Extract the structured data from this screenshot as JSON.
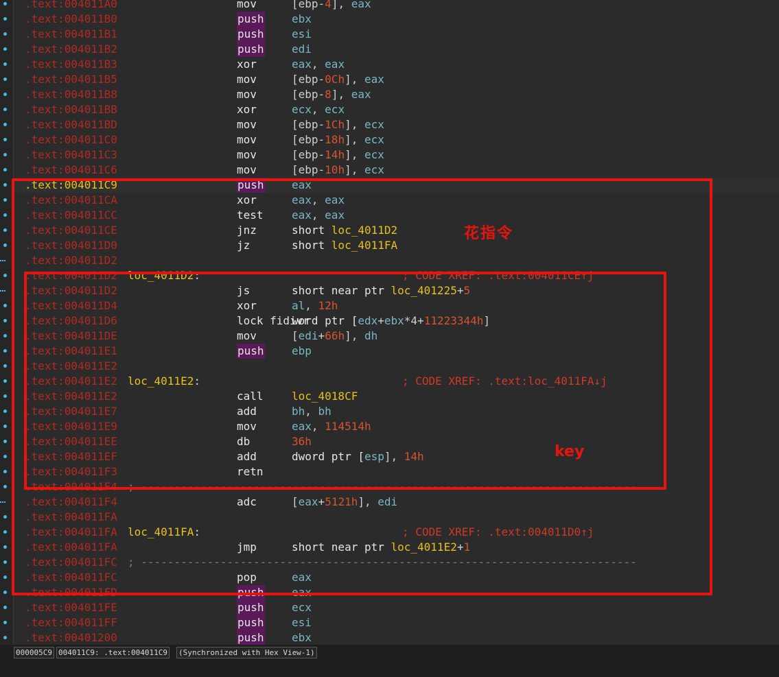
{
  "colors": {
    "background": "#2b2b2b",
    "address": "#b22a20",
    "current_address": "#e8c11a",
    "label": "#e8c11a",
    "register": "#7ab8c8",
    "number": "#d9532f",
    "annotation": "#e8140f"
  },
  "rows": [
    {
      "addr": ".text:004011A0",
      "mnem": "mov",
      "ops": [
        [
          "[ebp-",
          "sym"
        ],
        [
          "4",
          "n"
        ],
        [
          "], ",
          "sym"
        ],
        [
          "eax",
          "r"
        ]
      ]
    },
    {
      "addr": ".text:004011B0",
      "mnem": "push",
      "ops": [
        [
          "ebx",
          "r"
        ]
      ]
    },
    {
      "addr": ".text:004011B1",
      "mnem": "push",
      "ops": [
        [
          "esi",
          "r"
        ]
      ]
    },
    {
      "addr": ".text:004011B2",
      "mnem": "push",
      "ops": [
        [
          "edi",
          "r"
        ]
      ]
    },
    {
      "addr": ".text:004011B3",
      "mnem": "xor",
      "ops": [
        [
          "eax",
          "r"
        ],
        [
          ", ",
          "sym"
        ],
        [
          "eax",
          "r"
        ]
      ]
    },
    {
      "addr": ".text:004011B5",
      "mnem": "mov",
      "ops": [
        [
          "[ebp-",
          "sym"
        ],
        [
          "0Ch",
          "n"
        ],
        [
          "], ",
          "sym"
        ],
        [
          "eax",
          "r"
        ]
      ]
    },
    {
      "addr": ".text:004011B8",
      "mnem": "mov",
      "ops": [
        [
          "[ebp-",
          "sym"
        ],
        [
          "8",
          "n"
        ],
        [
          "], ",
          "sym"
        ],
        [
          "eax",
          "r"
        ]
      ]
    },
    {
      "addr": ".text:004011BB",
      "mnem": "xor",
      "ops": [
        [
          "ecx",
          "r"
        ],
        [
          ", ",
          "sym"
        ],
        [
          "ecx",
          "r"
        ]
      ]
    },
    {
      "addr": ".text:004011BD",
      "mnem": "mov",
      "ops": [
        [
          "[ebp-",
          "sym"
        ],
        [
          "1Ch",
          "n"
        ],
        [
          "], ",
          "sym"
        ],
        [
          "ecx",
          "r"
        ]
      ]
    },
    {
      "addr": ".text:004011C0",
      "mnem": "mov",
      "ops": [
        [
          "[ebp-",
          "sym"
        ],
        [
          "18h",
          "n"
        ],
        [
          "], ",
          "sym"
        ],
        [
          "ecx",
          "r"
        ]
      ]
    },
    {
      "addr": ".text:004011C3",
      "mnem": "mov",
      "ops": [
        [
          "[ebp-",
          "sym"
        ],
        [
          "14h",
          "n"
        ],
        [
          "], ",
          "sym"
        ],
        [
          "ecx",
          "r"
        ]
      ]
    },
    {
      "addr": ".text:004011C6",
      "mnem": "mov",
      "ops": [
        [
          "[ebp-",
          "sym"
        ],
        [
          "10h",
          "n"
        ],
        [
          "], ",
          "sym"
        ],
        [
          "ecx",
          "r"
        ]
      ]
    },
    {
      "addr": ".text:004011C9",
      "current": true,
      "mnem": "push",
      "ops": [
        [
          "eax",
          "r"
        ]
      ]
    },
    {
      "addr": ".text:004011CA",
      "mnem": "xor",
      "ops": [
        [
          "eax",
          "r"
        ],
        [
          ", ",
          "sym"
        ],
        [
          "eax",
          "r"
        ]
      ]
    },
    {
      "addr": ".text:004011CC",
      "mnem": "test",
      "ops": [
        [
          "eax",
          "r"
        ],
        [
          ", ",
          "sym"
        ],
        [
          "eax",
          "r"
        ]
      ]
    },
    {
      "addr": ".text:004011CE",
      "mnem": "jnz",
      "ops": [
        [
          "short ",
          "w"
        ],
        [
          "loc_4011D2",
          "y"
        ]
      ]
    },
    {
      "addr": ".text:004011D0",
      "mnem": "jz",
      "ops": [
        [
          "short ",
          "w"
        ],
        [
          "loc_4011FA",
          "y"
        ]
      ]
    },
    {
      "addr": ".text:004011D2"
    },
    {
      "addr": ".text:004011D2",
      "label": "loc_4011D2",
      "comment": "; CODE XREF: .text:004011CE↑j"
    },
    {
      "addr": ".text:004011D2",
      "mnem": "js",
      "ops": [
        [
          "short near ptr ",
          "w"
        ],
        [
          "loc_401225",
          "y"
        ],
        [
          "+",
          "sym"
        ],
        [
          "5",
          "n"
        ]
      ]
    },
    {
      "addr": ".text:004011D4",
      "mnem": "xor",
      "ops": [
        [
          "al",
          "r"
        ],
        [
          ", ",
          "sym"
        ],
        [
          "12h",
          "n"
        ]
      ]
    },
    {
      "addr": ".text:004011D6",
      "mnem": "lock fidivr",
      "ops": [
        [
          "word ptr [",
          "w"
        ],
        [
          "edx",
          "r"
        ],
        [
          "+",
          "sym"
        ],
        [
          "ebx",
          "r"
        ],
        [
          "*4+",
          "sym"
        ],
        [
          "11223344h",
          "n"
        ],
        [
          "]",
          "sym"
        ]
      ]
    },
    {
      "addr": ".text:004011DE",
      "mnem": "mov",
      "ops": [
        [
          "[",
          "sym"
        ],
        [
          "edi",
          "r"
        ],
        [
          "+",
          "sym"
        ],
        [
          "66h",
          "n"
        ],
        [
          "], ",
          "sym"
        ],
        [
          "dh",
          "r"
        ]
      ]
    },
    {
      "addr": ".text:004011E1",
      "mnem": "push",
      "ops": [
        [
          "ebp",
          "r"
        ]
      ]
    },
    {
      "addr": ".text:004011E2"
    },
    {
      "addr": ".text:004011E2",
      "label": "loc_4011E2",
      "comment": "; CODE XREF: .text:loc_4011FA↓j"
    },
    {
      "addr": ".text:004011E2",
      "mnem": "call",
      "ops": [
        [
          "loc_4018CF",
          "y"
        ]
      ]
    },
    {
      "addr": ".text:004011E7",
      "mnem": "add",
      "ops": [
        [
          "bh",
          "r"
        ],
        [
          ", ",
          "sym"
        ],
        [
          "bh",
          "r"
        ]
      ]
    },
    {
      "addr": ".text:004011E9",
      "mnem": "mov",
      "ops": [
        [
          "eax",
          "r"
        ],
        [
          ", ",
          "sym"
        ],
        [
          "114514h",
          "n"
        ]
      ]
    },
    {
      "addr": ".text:004011EE",
      "mnem": "db",
      "ops": [
        [
          "36h",
          "n"
        ]
      ]
    },
    {
      "addr": ".text:004011EF",
      "mnem": "add",
      "ops": [
        [
          "dword ptr [",
          "w"
        ],
        [
          "esp",
          "r"
        ],
        [
          "], ",
          "sym"
        ],
        [
          "14h",
          "n"
        ]
      ]
    },
    {
      "addr": ".text:004011F3",
      "mnem": "retn"
    },
    {
      "addr": ".text:004011F4",
      "sep": "; ---------------------------------------------------------------------------"
    },
    {
      "addr": ".text:004011F4",
      "mnem": "adc",
      "ops": [
        [
          "[",
          "sym"
        ],
        [
          "eax",
          "r"
        ],
        [
          "+",
          "sym"
        ],
        [
          "5121h",
          "n"
        ],
        [
          "], ",
          "sym"
        ],
        [
          "edi",
          "r"
        ]
      ]
    },
    {
      "addr": ".text:004011FA"
    },
    {
      "addr": ".text:004011FA",
      "label": "loc_4011FA",
      "comment": "; CODE XREF: .text:004011D0↑j"
    },
    {
      "addr": ".text:004011FA",
      "mnem": "jmp",
      "ops": [
        [
          "short near ptr ",
          "w"
        ],
        [
          "loc_4011E2",
          "y"
        ],
        [
          "+",
          "sym"
        ],
        [
          "1",
          "n"
        ]
      ]
    },
    {
      "addr": ".text:004011FC",
      "sep": "; ---------------------------------------------------------------------------"
    },
    {
      "addr": ".text:004011FC",
      "mnem": "pop",
      "ops": [
        [
          "eax",
          "r"
        ]
      ]
    },
    {
      "addr": ".text:004011FD",
      "mnem": "push",
      "ops": [
        [
          "eax",
          "r"
        ]
      ]
    },
    {
      "addr": ".text:004011FE",
      "mnem": "push",
      "ops": [
        [
          "ecx",
          "r"
        ]
      ]
    },
    {
      "addr": ".text:004011FF",
      "mnem": "push",
      "ops": [
        [
          "esi",
          "r"
        ]
      ]
    },
    {
      "addr": ".text:00401200",
      "mnem": "push",
      "ops": [
        [
          "ebx",
          "r"
        ]
      ]
    }
  ],
  "annotations": {
    "flower_instructions": "花指令",
    "key": "key"
  },
  "status": {
    "offset": "000005C9",
    "location": "004011C9: .text:004011C9",
    "sync": "(Synchronized with Hex View-1)"
  }
}
